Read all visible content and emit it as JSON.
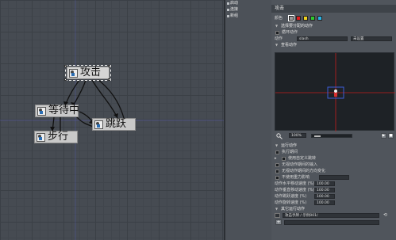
{
  "graph": {
    "nodes": {
      "attack": "攻击",
      "wait": "等待中",
      "jump": "跳跃",
      "walk": "步行"
    }
  },
  "mid_list": {
    "items": [
      "启动",
      "连接",
      "新组"
    ]
  },
  "inspector": {
    "title": "攻击",
    "color_label": "颜色",
    "colors": [
      "#9a9a9a",
      "#e01e1e",
      "#f0d21e",
      "#2ec82e",
      "#28b4e6"
    ],
    "section_play": "选择要分配的动作",
    "loop_label": "循环动作",
    "action_label": "动作",
    "action_value": "slash",
    "action_extra": "未设置",
    "section_preview": "查看动作",
    "zoom_value": "100%",
    "section_run": "运行动作",
    "run_options": [
      "执行期间",
      "使用自定义跳转",
      "无视动作期间的输入",
      "无视动作期间的方向变化"
    ],
    "gravity_label": "不使用重力影响",
    "params": [
      {
        "label": "动作水平移动速度 (%)",
        "value": "100.00"
      },
      {
        "label": "动作垂直移动速度 (%)",
        "value": "100.00"
      },
      {
        "label": "动作跳跃速度 (%)",
        "value": "100.00"
      },
      {
        "label": "动作旋转速度 (%)",
        "value": "100.00"
      }
    ],
    "section_other": "其它运行动作",
    "other_value": "攻击手牌 / 示例001/",
    "add_label": "+"
  }
}
